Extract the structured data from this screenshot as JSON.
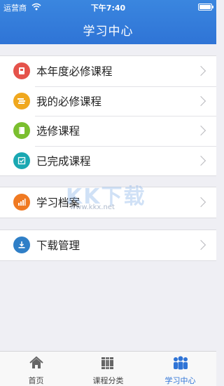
{
  "status_bar": {
    "carrier": "运营商",
    "time": "下午7:40"
  },
  "header": {
    "title": "学习中心"
  },
  "groups": [
    {
      "items": [
        {
          "label": "本年度必修课程",
          "icon": "book-icon",
          "color": "#e5534b"
        },
        {
          "label": "我的必修课程",
          "icon": "stack-icon",
          "color": "#f0a81e"
        },
        {
          "label": "选修课程",
          "icon": "note-icon",
          "color": "#7bbf2f"
        },
        {
          "label": "已完成课程",
          "icon": "checklist-icon",
          "color": "#1aa8b2"
        }
      ]
    },
    {
      "items": [
        {
          "label": "学习档案",
          "icon": "chart-icon",
          "color": "#f07a22"
        }
      ]
    },
    {
      "items": [
        {
          "label": "下载管理",
          "icon": "download-icon",
          "color": "#2f7fc7"
        }
      ]
    }
  ],
  "tabbar": {
    "tabs": [
      {
        "label": "首页",
        "icon": "home-icon",
        "active": false
      },
      {
        "label": "课程分类",
        "icon": "books-icon",
        "active": false
      },
      {
        "label": "学习中心",
        "icon": "people-icon",
        "active": true
      }
    ]
  },
  "colors": {
    "header": "#2f74d6",
    "active_tab": "#2f74d6",
    "background": "#efeff4"
  },
  "watermark": {
    "logo": "KK下载",
    "url": "www.kkx.net"
  }
}
